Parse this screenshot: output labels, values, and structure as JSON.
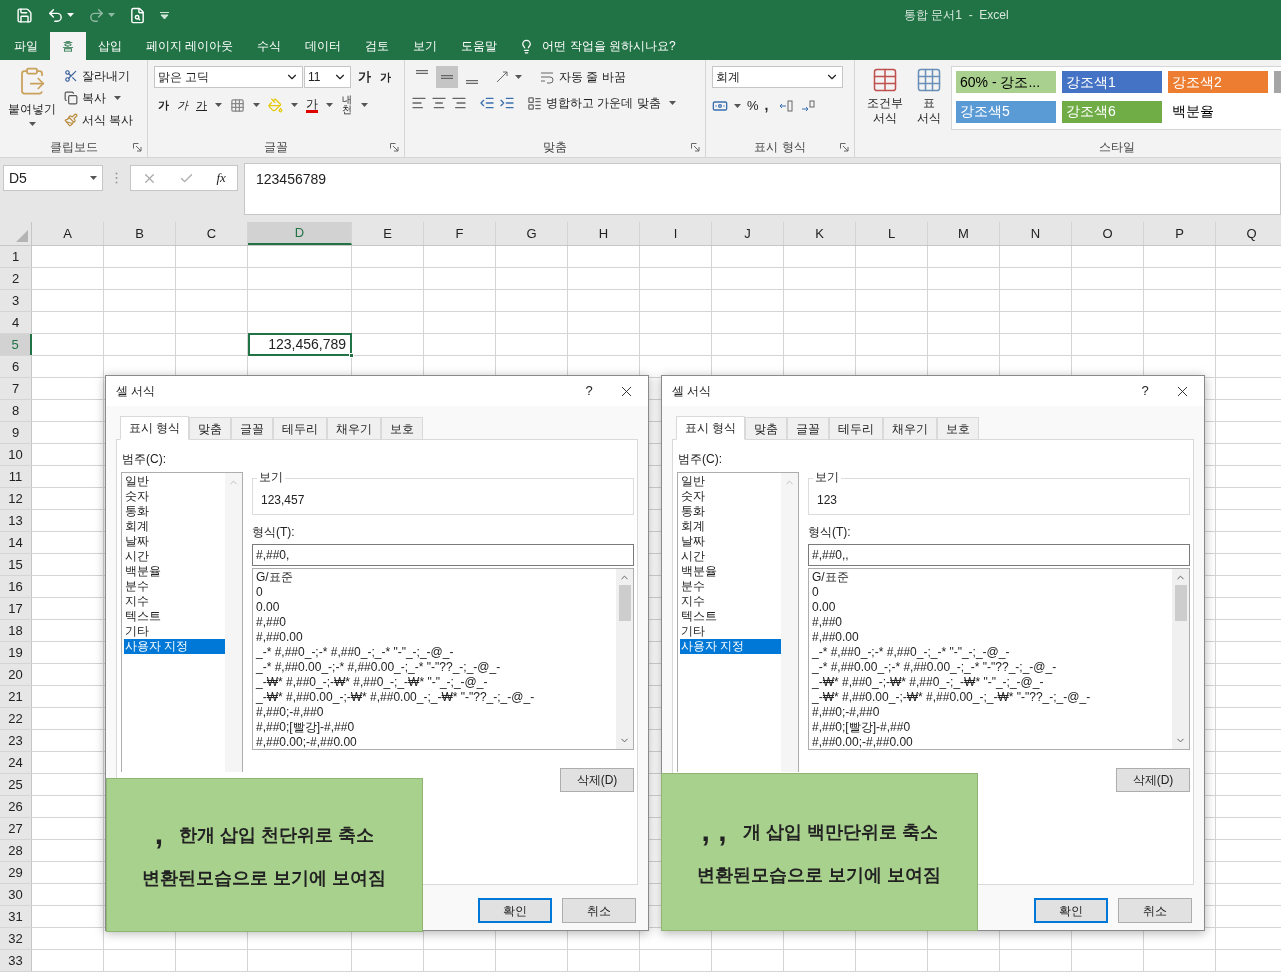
{
  "title_bar": {
    "title": "통합 문서1  -  Excel"
  },
  "ribbon_tabs": [
    {
      "label": "파일",
      "selected": false
    },
    {
      "label": "홈",
      "selected": true
    },
    {
      "label": "삽입",
      "selected": false
    },
    {
      "label": "페이지 레이아웃",
      "selected": false
    },
    {
      "label": "수식",
      "selected": false
    },
    {
      "label": "데이터",
      "selected": false
    },
    {
      "label": "검토",
      "selected": false
    },
    {
      "label": "보기",
      "selected": false
    },
    {
      "label": "도움말",
      "selected": false
    }
  ],
  "tell_me": {
    "placeholder": "어떤 작업을 원하시나요?"
  },
  "clipboard": {
    "paste": "붙여넣기",
    "cut": "잘라내기",
    "copy": "복사",
    "format_painter": "서식 복사",
    "label": "클립보드"
  },
  "font": {
    "name": "맑은 고딕",
    "size": "11",
    "grow": "가",
    "shrink": "가",
    "bold": "가",
    "italic": "가",
    "underline": "가",
    "font_color": "가",
    "phonetic": "내천",
    "label": "글꼴"
  },
  "alignment": {
    "vertical": [
      {
        "kind": "top",
        "selected": false
      },
      {
        "kind": "middle",
        "selected": true
      },
      {
        "kind": "bottom",
        "selected": false
      }
    ],
    "wrap_text": "자동 줄 바꿈",
    "merge_center": "병합하고 가운데 맞춤",
    "label": "맞춤"
  },
  "number": {
    "format": "회계",
    "percent": "%",
    "comma": ",",
    "label": "표시 형식"
  },
  "styles": {
    "conditional": "조건부 서식",
    "table": "표 서식",
    "label": "스타일",
    "cells": [
      {
        "label": "60% - 강조...",
        "color": "#a9d08e"
      },
      {
        "label": "강조색1",
        "color": "#4472c4"
      },
      {
        "label": "강조색2",
        "color": "#ed7d31"
      },
      {
        "color": "#a5a5a5"
      },
      {
        "label": "강조색5",
        "color": "#5b9bd5"
      },
      {
        "label": "강조색6",
        "color": "#70ad47"
      },
      {
        "label": "백분율",
        "color": "#ffffff"
      }
    ]
  },
  "formula_bar": {
    "name_box": "D5",
    "fx": "fx",
    "formula": "123456789"
  },
  "sheet": {
    "columns": [
      {
        "label": "A",
        "selected": false
      },
      {
        "label": "B",
        "selected": false
      },
      {
        "label": "C",
        "selected": false
      },
      {
        "label": "D",
        "selected": true
      },
      {
        "label": "E",
        "selected": false
      },
      {
        "label": "F",
        "selected": false
      },
      {
        "label": "G",
        "selected": false
      },
      {
        "label": "H",
        "selected": false
      },
      {
        "label": "I",
        "selected": false
      },
      {
        "label": "J",
        "selected": false
      },
      {
        "label": "K",
        "selected": false
      },
      {
        "label": "L",
        "selected": false
      },
      {
        "label": "M",
        "selected": false
      },
      {
        "label": "N",
        "selected": false
      },
      {
        "label": "O",
        "selected": false
      },
      {
        "label": "P",
        "selected": false
      },
      {
        "label": "Q",
        "selected": false
      }
    ],
    "rows": [
      {
        "label": "1",
        "selected": false
      },
      {
        "label": "2",
        "selected": false
      },
      {
        "label": "3",
        "selected": false
      },
      {
        "label": "4",
        "selected": false
      },
      {
        "label": "5",
        "selected": true
      },
      {
        "label": "6",
        "selected": false
      },
      {
        "label": "7",
        "selected": false
      },
      {
        "label": "8",
        "selected": false
      },
      {
        "label": "9",
        "selected": false
      },
      {
        "label": "10",
        "selected": false
      },
      {
        "label": "11",
        "selected": false
      },
      {
        "label": "12",
        "selected": false
      },
      {
        "label": "13",
        "selected": false
      },
      {
        "label": "14",
        "selected": false
      },
      {
        "label": "15",
        "selected": false
      },
      {
        "label": "16",
        "selected": false
      },
      {
        "label": "17",
        "selected": false
      },
      {
        "label": "18",
        "selected": false
      },
      {
        "label": "19",
        "selected": false
      },
      {
        "label": "20",
        "selected": false
      },
      {
        "label": "21",
        "selected": false
      },
      {
        "label": "22",
        "selected": false
      },
      {
        "label": "23",
        "selected": false
      },
      {
        "label": "24",
        "selected": false
      },
      {
        "label": "25",
        "selected": false
      },
      {
        "label": "26",
        "selected": false
      },
      {
        "label": "27",
        "selected": false
      },
      {
        "label": "28",
        "selected": false
      },
      {
        "label": "29",
        "selected": false
      },
      {
        "label": "30",
        "selected": false
      },
      {
        "label": "31",
        "selected": false
      },
      {
        "label": "32",
        "selected": false
      },
      {
        "label": "33",
        "selected": false
      }
    ],
    "active_cell": {
      "value": "123,456,789"
    }
  },
  "dialogs": [
    {
      "title": "셀 서식",
      "help": "?",
      "tabs": [
        {
          "label": "표시 형식",
          "selected": true
        },
        {
          "label": "맞춤",
          "selected": false
        },
        {
          "label": "글꼴",
          "selected": false
        },
        {
          "label": "테두리",
          "selected": false
        },
        {
          "label": "채우기",
          "selected": false
        },
        {
          "label": "보호",
          "selected": false
        }
      ],
      "category_label": "범주(C):",
      "categories": [
        {
          "label": "일반",
          "selected": false
        },
        {
          "label": "숫자",
          "selected": false
        },
        {
          "label": "통화",
          "selected": false
        },
        {
          "label": "회계",
          "selected": false
        },
        {
          "label": "날짜",
          "selected": false
        },
        {
          "label": "시간",
          "selected": false
        },
        {
          "label": "백분율",
          "selected": false
        },
        {
          "label": "분수",
          "selected": false
        },
        {
          "label": "지수",
          "selected": false
        },
        {
          "label": "텍스트",
          "selected": false
        },
        {
          "label": "기타",
          "selected": false
        },
        {
          "label": "사용자 지정",
          "selected": true
        }
      ],
      "sample_label": "보기",
      "sample": "123,457",
      "format_label": "형식(T):",
      "format_value": "#,##0,",
      "formats": [
        "G/표준",
        "0",
        "0.00",
        "#,##0",
        "#,##0.00",
        "_-* #,##0_-;-* #,##0_-;_-* \"-\"_-;_-@_-",
        "_-* #,##0.00_-;-* #,##0.00_-;_-* \"-\"??_-;_-@_-",
        "_-₩* #,##0_-;-₩* #,##0_-;_-₩* \"-\"_-;_-@_-",
        "_-₩* #,##0.00_-;-₩* #,##0.00_-;_-₩* \"-\"??_-;_-@_-",
        "#,##0;-#,##0",
        "#,##0;[빨강]-#,##0",
        "#,##0.00;-#,##0.00"
      ],
      "delete_button": "삭제(D)",
      "ok_button": "확인",
      "cancel_button": "취소",
      "callout": {
        "mark": ",",
        "text": "한개 삽입 천단위로 축소",
        "note": "변환된모습으로 보기에 보여짐"
      }
    },
    {
      "title": "셀 서식",
      "help": "?",
      "tabs": [
        {
          "label": "표시 형식",
          "selected": true
        },
        {
          "label": "맞춤",
          "selected": false
        },
        {
          "label": "글꼴",
          "selected": false
        },
        {
          "label": "테두리",
          "selected": false
        },
        {
          "label": "채우기",
          "selected": false
        },
        {
          "label": "보호",
          "selected": false
        }
      ],
      "category_label": "범주(C):",
      "categories": [
        {
          "label": "일반",
          "selected": false
        },
        {
          "label": "숫자",
          "selected": false
        },
        {
          "label": "통화",
          "selected": false
        },
        {
          "label": "회계",
          "selected": false
        },
        {
          "label": "날짜",
          "selected": false
        },
        {
          "label": "시간",
          "selected": false
        },
        {
          "label": "백분율",
          "selected": false
        },
        {
          "label": "분수",
          "selected": false
        },
        {
          "label": "지수",
          "selected": false
        },
        {
          "label": "텍스트",
          "selected": false
        },
        {
          "label": "기타",
          "selected": false
        },
        {
          "label": "사용자 지정",
          "selected": true
        }
      ],
      "sample_label": "보기",
      "sample": "123",
      "format_label": "형식(T):",
      "format_value": "#,##0,,",
      "formats": [
        "G/표준",
        "0",
        "0.00",
        "#,##0",
        "#,##0.00",
        "_-* #,##0_-;-* #,##0_-;_-* \"-\"_-;_-@_-",
        "_-* #,##0.00_-;-* #,##0.00_-;_-* \"-\"??_-;_-@_-",
        "_-₩* #,##0_-;-₩* #,##0_-;_-₩* \"-\"_-;_-@_-",
        "_-₩* #,##0.00_-;-₩* #,##0.00_-;_-₩* \"-\"??_-;_-@_-",
        "#,##0;-#,##0",
        "#,##0;[빨강]-#,##0",
        "#,##0.00;-#,##0.00"
      ],
      "delete_button": "삭제(D)",
      "ok_button": "확인",
      "cancel_button": "취소",
      "callout": {
        "mark": ", ,",
        "text": "개 삽입 백만단위로 축소",
        "note": "변환된모습으로 보기에 보여짐"
      }
    }
  ]
}
